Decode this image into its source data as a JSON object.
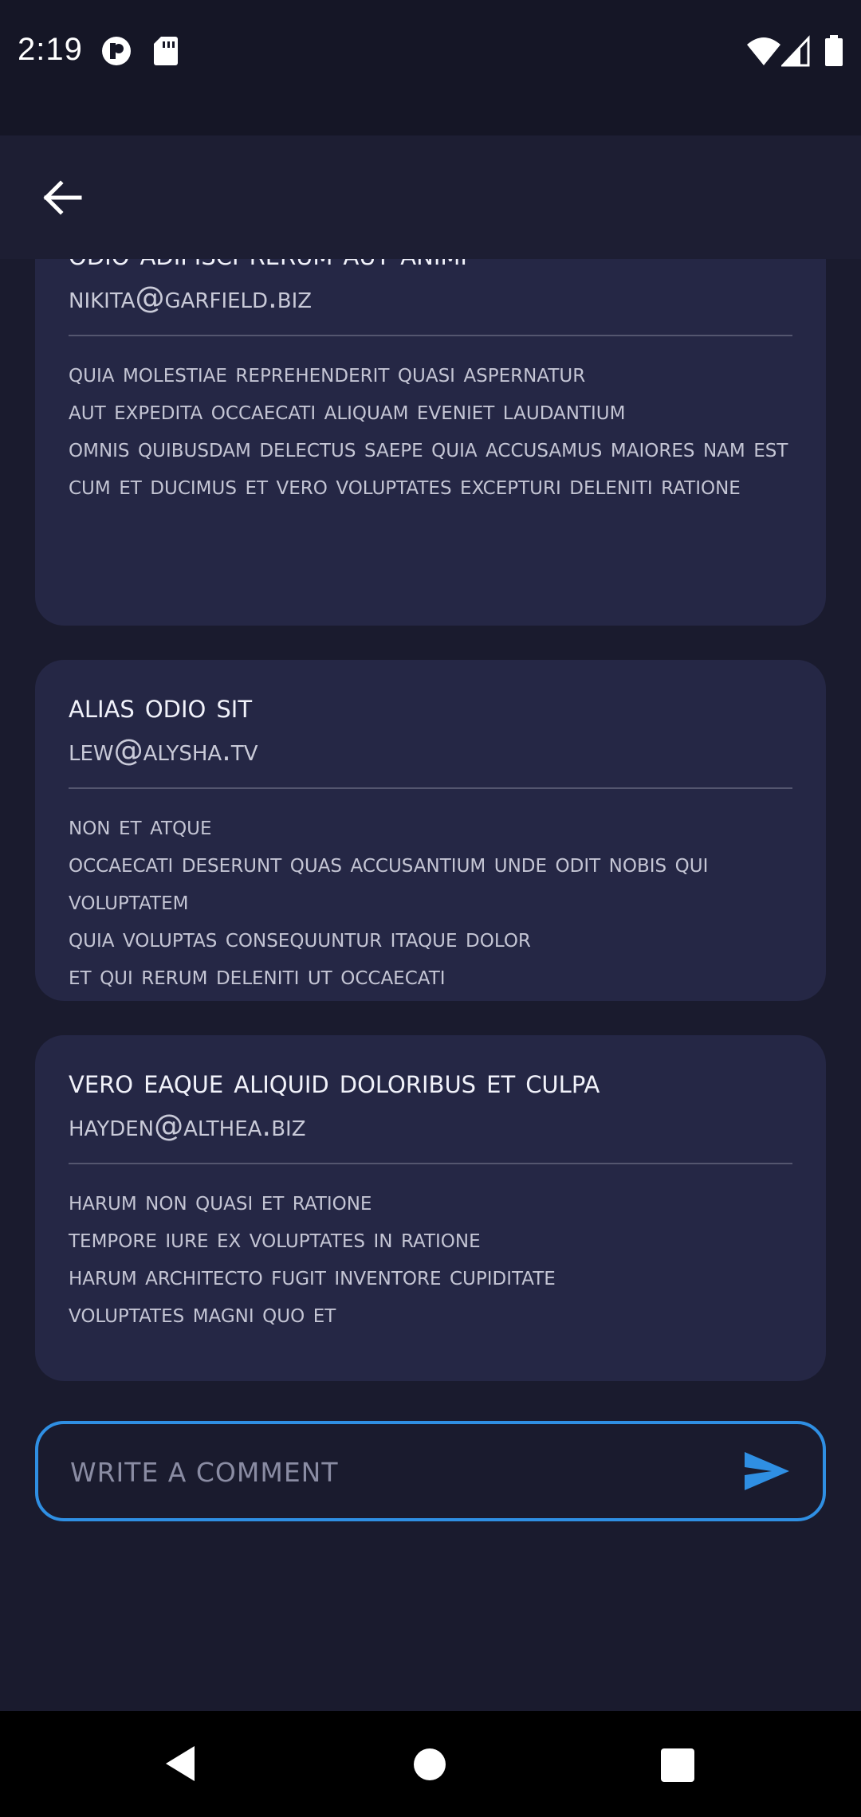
{
  "status_bar": {
    "time": "2:19"
  },
  "comment": {
    "placeholder": "WRITE A COMMENT"
  },
  "comments": [
    {
      "title": "Odio adipisci rerum aut animi",
      "email": "Nikita@garfield.biz",
      "body": "quia molestiae reprehenderit quasi aspernatur\naut expedita occaecati aliquam eveniet laudantium\nomnis quibusdam delectus saepe quia accusamus maiores nam est\ncum et ducimus et vero voluptates excepturi deleniti ratione"
    },
    {
      "title": "alias odio sit",
      "email": "Lew@alysha.tv",
      "body": "non et atque\noccaecati deserunt quas accusantium unde odit nobis qui voluptatem\nquia voluptas consequuntur itaque dolor\net qui rerum deleniti ut occaecati"
    },
    {
      "title": "vero eaque aliquid doloribus et culpa",
      "email": "Hayden@althea.biz",
      "body": "harum non quasi et ratione\ntempore iure ex voluptates in ratione\nharum architecto fugit inventore cupiditate\nvoluptates magni quo et"
    }
  ]
}
